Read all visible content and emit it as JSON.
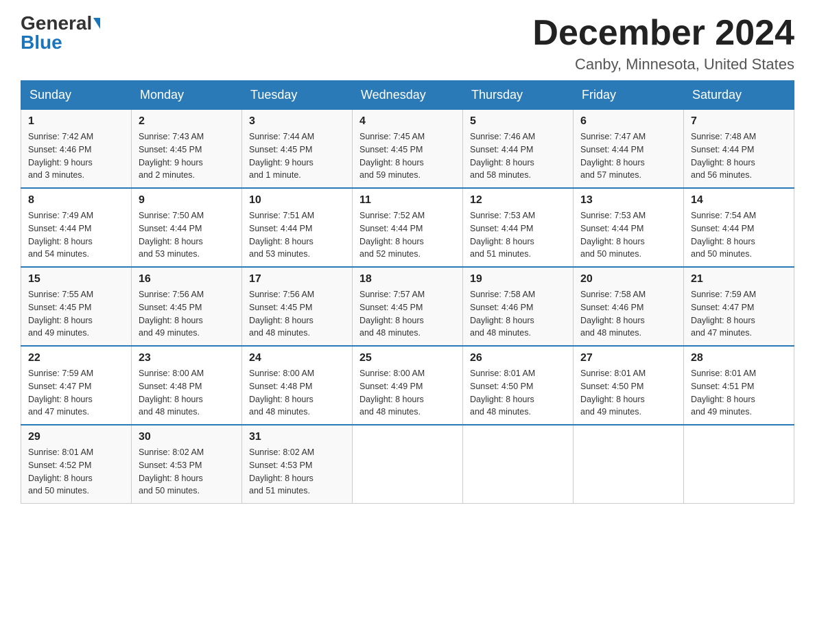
{
  "header": {
    "logo_general": "General",
    "logo_blue": "Blue",
    "month_title": "December 2024",
    "location": "Canby, Minnesota, United States"
  },
  "weekdays": [
    "Sunday",
    "Monday",
    "Tuesday",
    "Wednesday",
    "Thursday",
    "Friday",
    "Saturday"
  ],
  "weeks": [
    [
      {
        "day": "1",
        "sunrise": "7:42 AM",
        "sunset": "4:46 PM",
        "daylight": "9 hours and 3 minutes."
      },
      {
        "day": "2",
        "sunrise": "7:43 AM",
        "sunset": "4:45 PM",
        "daylight": "9 hours and 2 minutes."
      },
      {
        "day": "3",
        "sunrise": "7:44 AM",
        "sunset": "4:45 PM",
        "daylight": "9 hours and 1 minute."
      },
      {
        "day": "4",
        "sunrise": "7:45 AM",
        "sunset": "4:45 PM",
        "daylight": "8 hours and 59 minutes."
      },
      {
        "day": "5",
        "sunrise": "7:46 AM",
        "sunset": "4:44 PM",
        "daylight": "8 hours and 58 minutes."
      },
      {
        "day": "6",
        "sunrise": "7:47 AM",
        "sunset": "4:44 PM",
        "daylight": "8 hours and 57 minutes."
      },
      {
        "day": "7",
        "sunrise": "7:48 AM",
        "sunset": "4:44 PM",
        "daylight": "8 hours and 56 minutes."
      }
    ],
    [
      {
        "day": "8",
        "sunrise": "7:49 AM",
        "sunset": "4:44 PM",
        "daylight": "8 hours and 54 minutes."
      },
      {
        "day": "9",
        "sunrise": "7:50 AM",
        "sunset": "4:44 PM",
        "daylight": "8 hours and 53 minutes."
      },
      {
        "day": "10",
        "sunrise": "7:51 AM",
        "sunset": "4:44 PM",
        "daylight": "8 hours and 53 minutes."
      },
      {
        "day": "11",
        "sunrise": "7:52 AM",
        "sunset": "4:44 PM",
        "daylight": "8 hours and 52 minutes."
      },
      {
        "day": "12",
        "sunrise": "7:53 AM",
        "sunset": "4:44 PM",
        "daylight": "8 hours and 51 minutes."
      },
      {
        "day": "13",
        "sunrise": "7:53 AM",
        "sunset": "4:44 PM",
        "daylight": "8 hours and 50 minutes."
      },
      {
        "day": "14",
        "sunrise": "7:54 AM",
        "sunset": "4:44 PM",
        "daylight": "8 hours and 50 minutes."
      }
    ],
    [
      {
        "day": "15",
        "sunrise": "7:55 AM",
        "sunset": "4:45 PM",
        "daylight": "8 hours and 49 minutes."
      },
      {
        "day": "16",
        "sunrise": "7:56 AM",
        "sunset": "4:45 PM",
        "daylight": "8 hours and 49 minutes."
      },
      {
        "day": "17",
        "sunrise": "7:56 AM",
        "sunset": "4:45 PM",
        "daylight": "8 hours and 48 minutes."
      },
      {
        "day": "18",
        "sunrise": "7:57 AM",
        "sunset": "4:45 PM",
        "daylight": "8 hours and 48 minutes."
      },
      {
        "day": "19",
        "sunrise": "7:58 AM",
        "sunset": "4:46 PM",
        "daylight": "8 hours and 48 minutes."
      },
      {
        "day": "20",
        "sunrise": "7:58 AM",
        "sunset": "4:46 PM",
        "daylight": "8 hours and 48 minutes."
      },
      {
        "day": "21",
        "sunrise": "7:59 AM",
        "sunset": "4:47 PM",
        "daylight": "8 hours and 47 minutes."
      }
    ],
    [
      {
        "day": "22",
        "sunrise": "7:59 AM",
        "sunset": "4:47 PM",
        "daylight": "8 hours and 47 minutes."
      },
      {
        "day": "23",
        "sunrise": "8:00 AM",
        "sunset": "4:48 PM",
        "daylight": "8 hours and 48 minutes."
      },
      {
        "day": "24",
        "sunrise": "8:00 AM",
        "sunset": "4:48 PM",
        "daylight": "8 hours and 48 minutes."
      },
      {
        "day": "25",
        "sunrise": "8:00 AM",
        "sunset": "4:49 PM",
        "daylight": "8 hours and 48 minutes."
      },
      {
        "day": "26",
        "sunrise": "8:01 AM",
        "sunset": "4:50 PM",
        "daylight": "8 hours and 48 minutes."
      },
      {
        "day": "27",
        "sunrise": "8:01 AM",
        "sunset": "4:50 PM",
        "daylight": "8 hours and 49 minutes."
      },
      {
        "day": "28",
        "sunrise": "8:01 AM",
        "sunset": "4:51 PM",
        "daylight": "8 hours and 49 minutes."
      }
    ],
    [
      {
        "day": "29",
        "sunrise": "8:01 AM",
        "sunset": "4:52 PM",
        "daylight": "8 hours and 50 minutes."
      },
      {
        "day": "30",
        "sunrise": "8:02 AM",
        "sunset": "4:53 PM",
        "daylight": "8 hours and 50 minutes."
      },
      {
        "day": "31",
        "sunrise": "8:02 AM",
        "sunset": "4:53 PM",
        "daylight": "8 hours and 51 minutes."
      },
      null,
      null,
      null,
      null
    ]
  ],
  "labels": {
    "sunrise": "Sunrise:",
    "sunset": "Sunset:",
    "daylight": "Daylight:"
  }
}
